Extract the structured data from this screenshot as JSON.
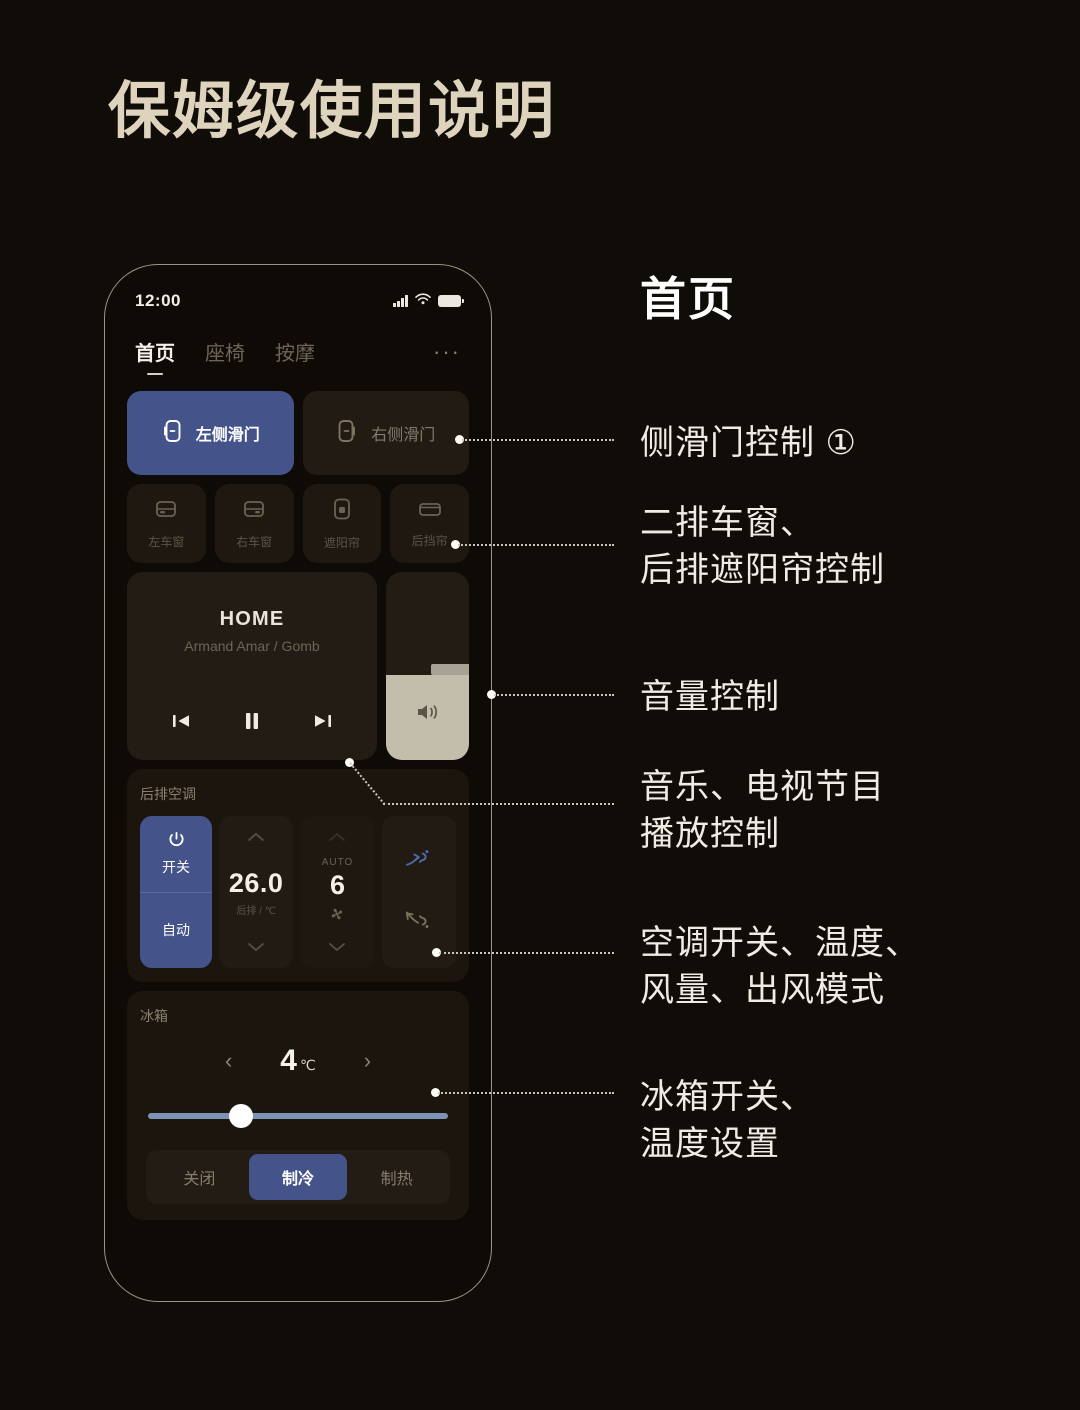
{
  "page": {
    "title": "保姆级使用说明",
    "accent_blue": "#44548b",
    "background": "#100c07",
    "title_color": "#ded3bd"
  },
  "phone": {
    "status_bar": {
      "time": "12:00",
      "icons": [
        "signal-icon",
        "wifi-icon",
        "battery-icon"
      ]
    },
    "tabs": [
      {
        "label": "首页",
        "active": true
      },
      {
        "label": "座椅",
        "active": false
      },
      {
        "label": "按摩",
        "active": false
      }
    ],
    "more_label": "···",
    "doors": [
      {
        "label": "左侧滑门",
        "icon": "sliding-door-left-icon",
        "active": true
      },
      {
        "label": "右侧滑门",
        "icon": "sliding-door-right-icon",
        "active": false
      }
    ],
    "windows": [
      {
        "label": "左车窗",
        "icon": "window-left-icon"
      },
      {
        "label": "右车窗",
        "icon": "window-right-icon"
      },
      {
        "label": "遮阳帘",
        "icon": "sunshade-curtain-icon"
      },
      {
        "label": "后挡帘",
        "icon": "rear-shade-icon"
      }
    ],
    "media": {
      "track_title": "HOME",
      "track_artist": "Armand Amar / Gomb",
      "controls": [
        "previous-track-icon",
        "pause-icon",
        "next-track-icon"
      ]
    },
    "volume": {
      "icon": "speaker-icon",
      "level_percent": 45
    },
    "ac": {
      "title": "后排空调",
      "power_label": "开关",
      "auto_label": "自动",
      "temperature": "26.0",
      "temperature_sub": "后排 / ℃",
      "fan_auto_label": "AUTO",
      "fan_value": "6",
      "mode_icons": [
        "airflow-face-icon",
        "airflow-feet-icon"
      ]
    },
    "fridge": {
      "title": "冰箱",
      "temperature": "4",
      "unit": "℃",
      "prev_icon": "chevron-left-icon",
      "next_icon": "chevron-right-icon",
      "slider_percent": 31,
      "modes": [
        {
          "label": "关闭",
          "active": false
        },
        {
          "label": "制冷",
          "active": true
        },
        {
          "label": "制热",
          "active": false
        }
      ]
    }
  },
  "annotations": {
    "heading": "首页",
    "items": [
      {
        "text": "侧滑门控制 ①"
      },
      {
        "text": "二排车窗、\n后排遮阳帘控制"
      },
      {
        "text": "音量控制"
      },
      {
        "text": "音乐、电视节目\n播放控制"
      },
      {
        "text": "空调开关、温度、\n风量、出风模式"
      },
      {
        "text": "冰箱开关、\n温度设置"
      }
    ]
  }
}
